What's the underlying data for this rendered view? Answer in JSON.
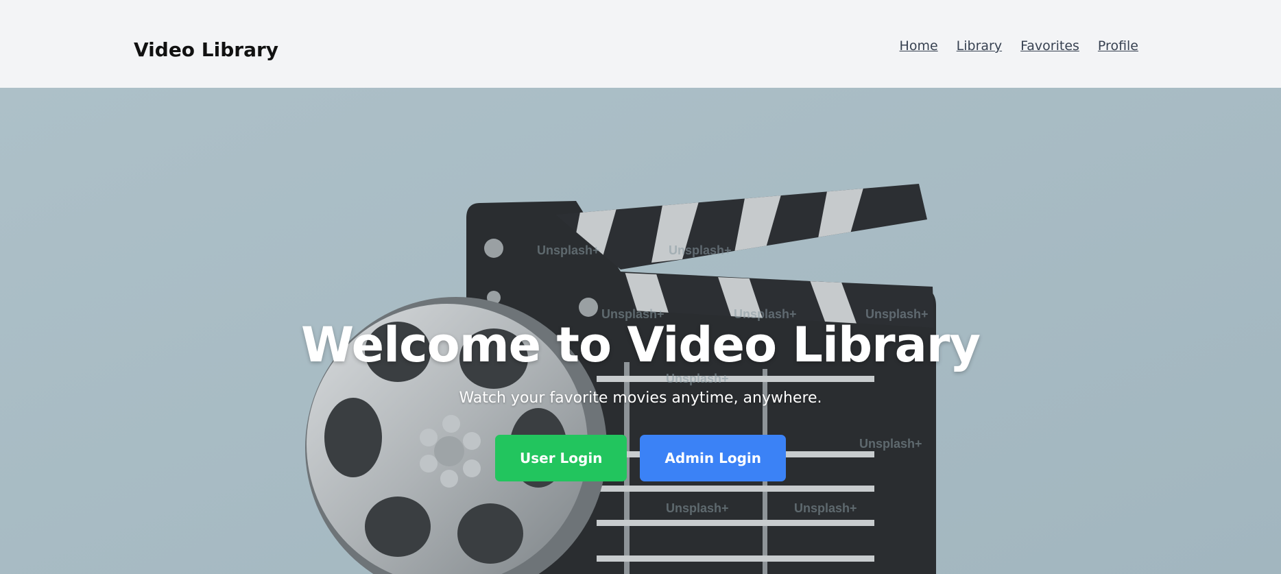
{
  "header": {
    "brand": "Video Library",
    "nav": [
      {
        "label": "Home"
      },
      {
        "label": "Library"
      },
      {
        "label": "Favorites"
      },
      {
        "label": "Profile"
      }
    ]
  },
  "hero": {
    "title": "Welcome to Video Library",
    "subtitle": "Watch your favorite movies anytime, anywhere.",
    "buttons": {
      "user_login": "User Login",
      "admin_login": "Admin Login"
    },
    "watermark": "Unsplash+"
  },
  "colors": {
    "header_bg": "#f3f4f6",
    "hero_bg": "#a9bcc4",
    "user_button": "#22c55e",
    "admin_button": "#3b82f6"
  }
}
